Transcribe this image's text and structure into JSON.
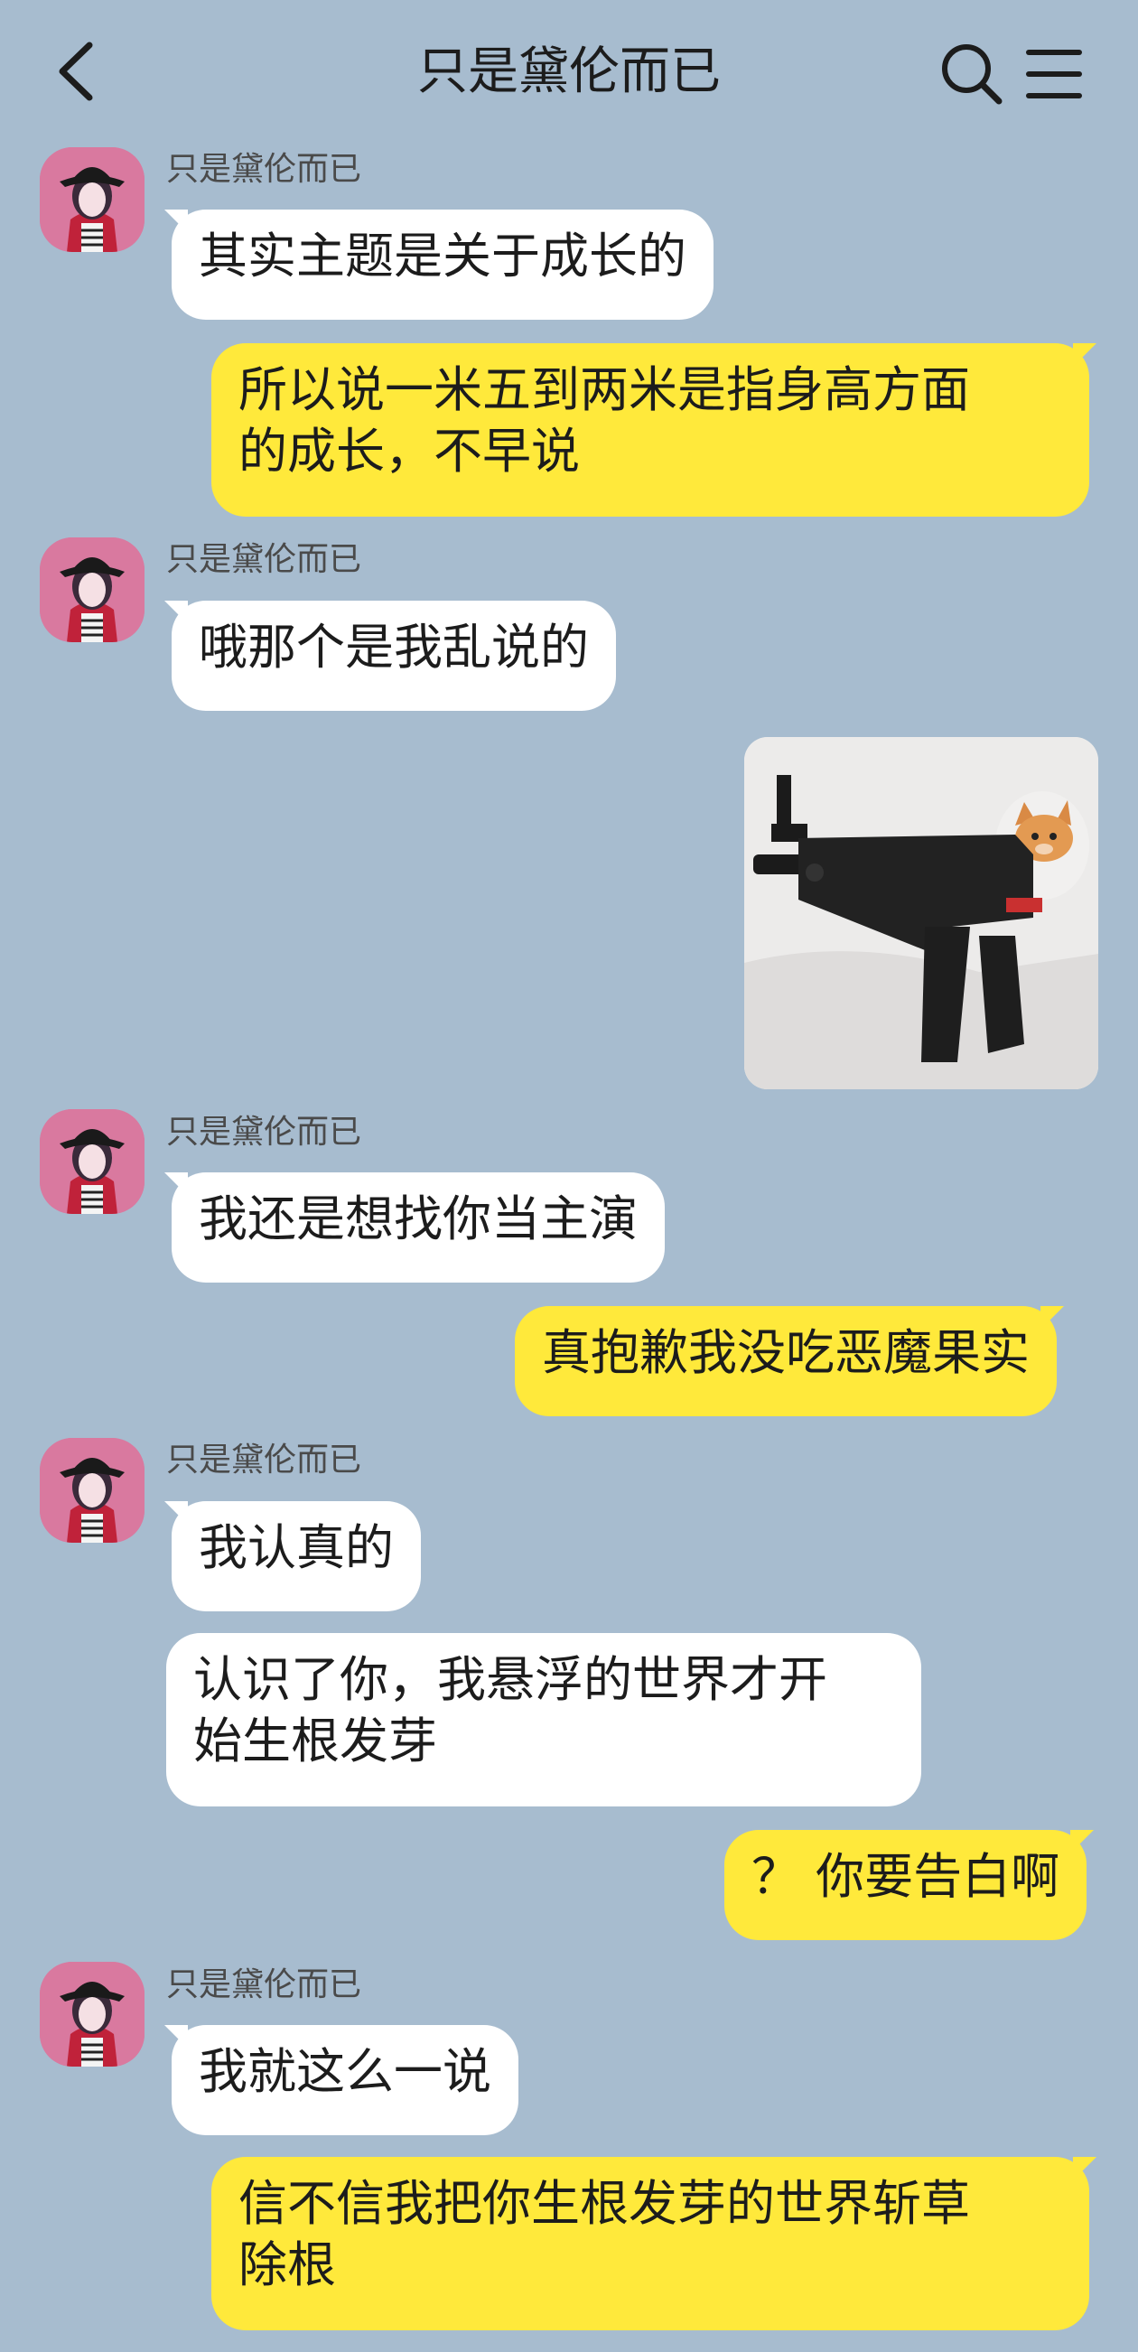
{
  "header": {
    "title": "只是黛伦而已",
    "back_icon": "chevron-left-icon",
    "search_icon": "search-icon",
    "menu_icon": "menu-icon"
  },
  "colors": {
    "background": "#a7bccf",
    "incoming_bubble": "#ffffff",
    "outgoing_bubble": "#ffe93b",
    "avatar_accent": "#d9799f"
  },
  "messages": [
    {
      "side": "incoming",
      "sender": "只是黛伦而已",
      "text": "其实主题是关于成长的"
    },
    {
      "side": "outgoing",
      "lines": [
        "所以说一米五到两米是指身高方面",
        "的成长，不早说"
      ]
    },
    {
      "side": "incoming",
      "sender": "只是黛伦而已",
      "text": "哦那个是我乱说的"
    },
    {
      "side": "outgoing",
      "type": "image",
      "image": "toy-gun-with-cat-photo"
    },
    {
      "side": "incoming",
      "sender": "只是黛伦而已",
      "text": "我还是想找你当主演"
    },
    {
      "side": "outgoing",
      "text": "真抱歉我没吃恶魔果实"
    },
    {
      "side": "incoming",
      "sender": "只是黛伦而已",
      "text": "我认真的"
    },
    {
      "side": "incoming",
      "lines": [
        "认识了你，我悬浮的世界才开",
        "始生根发芽"
      ]
    },
    {
      "side": "outgoing",
      "text": "？ 你要告白啊"
    },
    {
      "side": "incoming",
      "sender": "只是黛伦而已",
      "text": "我就这么一说"
    },
    {
      "side": "outgoing",
      "lines": [
        "信不信我把你生根发芽的世界斩草",
        "除根"
      ]
    }
  ]
}
